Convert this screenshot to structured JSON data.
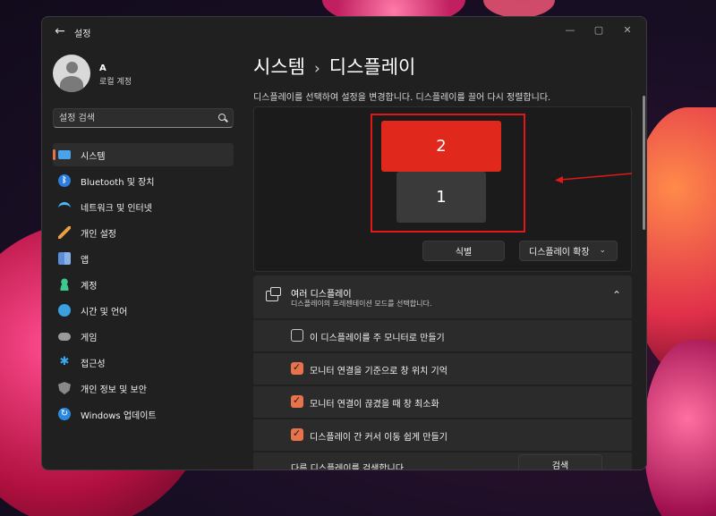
{
  "window": {
    "app_title": "설정",
    "back_icon": "back-arrow-icon",
    "controls": {
      "minimize": "—",
      "maximize": "▢",
      "close": "✕"
    }
  },
  "user": {
    "name": "A",
    "account_type": "로컬 계정"
  },
  "search": {
    "placeholder": "설정 검색"
  },
  "sidebar": {
    "items": [
      {
        "label": "시스템",
        "icon": "system-icon",
        "active": true
      },
      {
        "label": "Bluetooth 및 장치",
        "icon": "bluetooth-icon",
        "active": false
      },
      {
        "label": "네트워크 및 인터넷",
        "icon": "network-icon",
        "active": false
      },
      {
        "label": "개인 설정",
        "icon": "personalization-brush-icon",
        "active": false
      },
      {
        "label": "앱",
        "icon": "apps-icon",
        "active": false
      },
      {
        "label": "계정",
        "icon": "account-icon",
        "active": false
      },
      {
        "label": "시간 및 언어",
        "icon": "time-language-icon",
        "active": false
      },
      {
        "label": "게임",
        "icon": "gaming-icon",
        "active": false
      },
      {
        "label": "접근성",
        "icon": "accessibility-icon",
        "active": false
      },
      {
        "label": "개인 정보 및 보안",
        "icon": "privacy-shield-icon",
        "active": false
      },
      {
        "label": "Windows 업데이트",
        "icon": "windows-update-icon",
        "active": false
      }
    ],
    "accent_color": "#e8724a"
  },
  "main": {
    "breadcrumb_parent": "시스템",
    "breadcrumb_separator": "›",
    "breadcrumb_current": "디스플레이",
    "description": "디스플레이를 선택하여 설정을 변경합니다. 디스플레이를 끌어 다시 정렬합니다.",
    "monitors": [
      {
        "number": "2",
        "selected": true,
        "color": "#e0281c"
      },
      {
        "number": "1",
        "selected": false,
        "color": "#3a3a3a"
      }
    ],
    "identify_button": "식별",
    "display_mode": "디스플레이 확장",
    "display_mode_chevron": "⌄"
  },
  "multi_display": {
    "title": "여러 디스플레이",
    "subtitle": "디스플레이의 프레젠테이션 모드를 선택합니다.",
    "collapse_chevron": "⌃",
    "options": [
      {
        "label": "이 디스플레이를 주 모니터로 만들기",
        "checked": false
      },
      {
        "label": "모니터 연결을 기준으로 창 위치 기억",
        "checked": true
      },
      {
        "label": "모니터 연결이 끊겼을 때 창 최소화",
        "checked": true
      },
      {
        "label": "디스플레이 간 커서 이동 쉽게 만들기",
        "checked": true
      }
    ],
    "detect_label": "다른 디스플레이를 검색합니다.",
    "detect_button": "검색"
  },
  "annotation_color": "#e01818"
}
